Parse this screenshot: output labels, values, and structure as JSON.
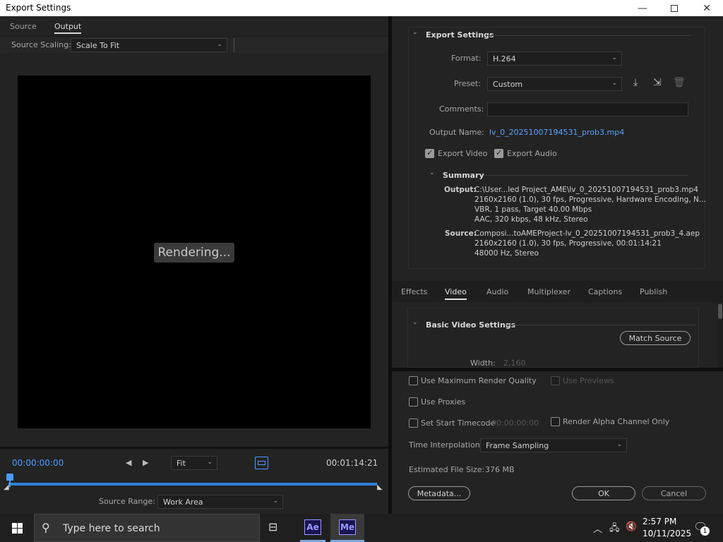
{
  "window": {
    "title": "Export Settings"
  },
  "left": {
    "tabs": [
      "Source",
      "Output"
    ],
    "source_scaling_label": "Source Scaling:",
    "source_scaling_value": "Scale To Fit",
    "rendering_text": "Rendering...",
    "timecode_start": "00:00:00:00",
    "timecode_end": "00:01:14:21",
    "zoom_value": "Fit",
    "source_range_label": "Source Range:",
    "source_range_value": "Work Area"
  },
  "export_settings": {
    "header": "Export Settings",
    "format_label": "Format:",
    "format_value": "H.264",
    "preset_label": "Preset:",
    "preset_value": "Custom",
    "comments_label": "Comments:",
    "comments_value": "",
    "output_name_label": "Output Name:",
    "output_name_value": "lv_0_20251007194531_prob3.mp4",
    "export_video_label": "Export Video",
    "export_audio_label": "Export Audio",
    "summary_header": "Summary",
    "output_label": "Output:",
    "output_lines": [
      "C:\\User...led Project_AME\\lv_0_20251007194531_prob3.mp4",
      "2160x2160 (1.0), 30 fps, Progressive, Hardware Encoding, N...",
      "VBR, 1 pass, Target 40.00 Mbps",
      "AAC, 320 kbps, 48 kHz, Stereo"
    ],
    "source_label": "Source:",
    "source_lines": [
      "Composi...toAMEProject-lv_0_20251007194531_prob3_4.aep",
      "2160x2160 (1.0), 30 fps, Progressive, 00:01:14:21",
      "48000 Hz, Stereo"
    ]
  },
  "subtabs": [
    "Effects",
    "Video",
    "Audio",
    "Multiplexer",
    "Captions",
    "Publish"
  ],
  "video": {
    "basic_header": "Basic Video Settings",
    "match_source": "Match Source",
    "width_label": "Width:",
    "width_value": "2,160"
  },
  "options": {
    "max_render_quality": "Use Maximum Render Quality",
    "use_previews": "Use Previews",
    "use_proxies": "Use Proxies",
    "set_start_timecode": "Set Start Timecode",
    "start_timecode_value": "00:00:00:00",
    "render_alpha": "Render Alpha Channel Only",
    "time_interp_label": "Time Interpolation:",
    "time_interp_value": "Frame Sampling",
    "est_size_label": "Estimated File Size:",
    "est_size_value": "376 MB"
  },
  "buttons": {
    "metadata": "Metadata...",
    "ok": "OK",
    "cancel": "Cancel"
  },
  "taskbar": {
    "search_placeholder": "Type here to search",
    "ae_label": "Ae",
    "me_label": "Me",
    "time": "2:57 PM",
    "date": "10/11/2025",
    "notif_count": "1"
  },
  "colors": {
    "accent": "#4a9cff",
    "link": "#5aa2ff"
  }
}
